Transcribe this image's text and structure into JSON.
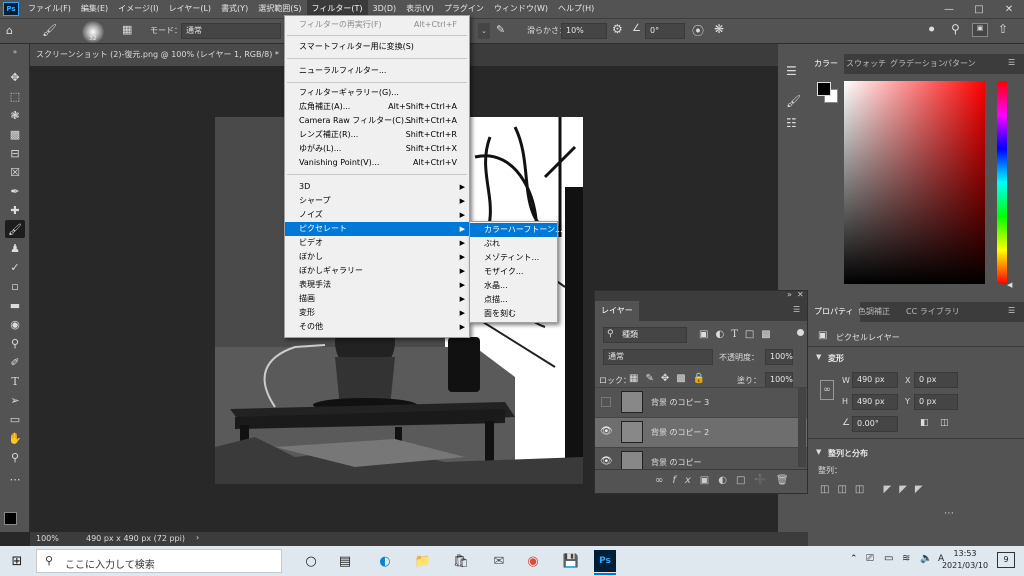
{
  "menubar": {
    "app_icon": "Ps",
    "items": [
      "ファイル(F)",
      "編集(E)",
      "イメージ(I)",
      "レイヤー(L)",
      "書式(Y)",
      "選択範囲(S)",
      "フィルター(T)",
      "3D(D)",
      "表示(V)",
      "プラグイン",
      "ウィンドウ(W)",
      "ヘルプ(H)"
    ]
  },
  "options": {
    "brush_size": "32",
    "mode_label": "モード：",
    "mode_value": "通常",
    "smoothing_label": "滑らかさ：",
    "smoothing_value": "10%",
    "angle_value": "0°"
  },
  "document_tab": "スクリーンショット (2)-復元.png @ 100% (レイヤー 1, RGB/8) *",
  "status": {
    "zoom": "100%",
    "size": "490 px x 490 px (72 ppi)"
  },
  "filter_menu": {
    "last_filter": "フィルターの再実行(F)",
    "last_filter_shortcut": "Alt+Ctrl+F",
    "smart_filter": "スマートフィルター用に変換(S)",
    "neural": "ニューラルフィルター...",
    "items": [
      {
        "label": "フィルターギャラリー(G)...",
        "shortcut": ""
      },
      {
        "label": "広角補正(A)...",
        "shortcut": "Alt+Shift+Ctrl+A"
      },
      {
        "label": "Camera Raw フィルター(C)...",
        "shortcut": "Shift+Ctrl+A"
      },
      {
        "label": "レンズ補正(R)...",
        "shortcut": "Shift+Ctrl+R"
      },
      {
        "label": "ゆがみ(L)...",
        "shortcut": "Shift+Ctrl+X"
      },
      {
        "label": "Vanishing Point(V)...",
        "shortcut": "Alt+Ctrl+V"
      }
    ],
    "submenus": [
      "3D",
      "シャープ",
      "ノイズ",
      "ピクセレート",
      "ビデオ",
      "ぼかし",
      "ぼかしギャラリー",
      "表現手法",
      "描画",
      "変形",
      "その他"
    ]
  },
  "pixelate_submenu": [
    "カラーハーフトーン...",
    "ぶれ",
    "メゾティント...",
    "モザイク...",
    "水晶...",
    "点描...",
    "面を刻む"
  ],
  "color_panel": {
    "tabs": [
      "カラー",
      "スウォッチ",
      "グラデーション",
      "パターン"
    ]
  },
  "properties_panel": {
    "tabs": [
      "プロパティ",
      "色調補正",
      "CC ライブラリ"
    ],
    "type_label": "ピクセルレイヤー",
    "transform_label": "変形",
    "w_label": "W",
    "w_value": "490 px",
    "x_label": "X",
    "x_value": "0 px",
    "h_label": "H",
    "h_value": "490 px",
    "y_label": "Y",
    "y_value": "0 px",
    "angle": "0.00°",
    "align_label": "整列と分布",
    "align_sub": "整列："
  },
  "layers_panel": {
    "title": "レイヤー",
    "kind_label": "種類",
    "blend": "通常",
    "opacity_label": "不透明度：",
    "opacity_value": "100%",
    "lock_label": "ロック：",
    "fill_label": "塗り：",
    "fill_value": "100%",
    "layers": [
      {
        "name": "背景 のコピー 3",
        "visible": false,
        "selected": false
      },
      {
        "name": "背景 のコピー 2",
        "visible": true,
        "selected": true
      },
      {
        "name": "背景 のコピー",
        "visible": true,
        "selected": false
      }
    ]
  },
  "taskbar": {
    "search_placeholder": "ここに入力して検索",
    "ime": "A",
    "time": "13:53",
    "date": "2021/03/10",
    "notifications": "9"
  },
  "colors": {
    "accent": "#0078d7",
    "ps_blue": "#31a8ff",
    "panel": "#535353"
  }
}
